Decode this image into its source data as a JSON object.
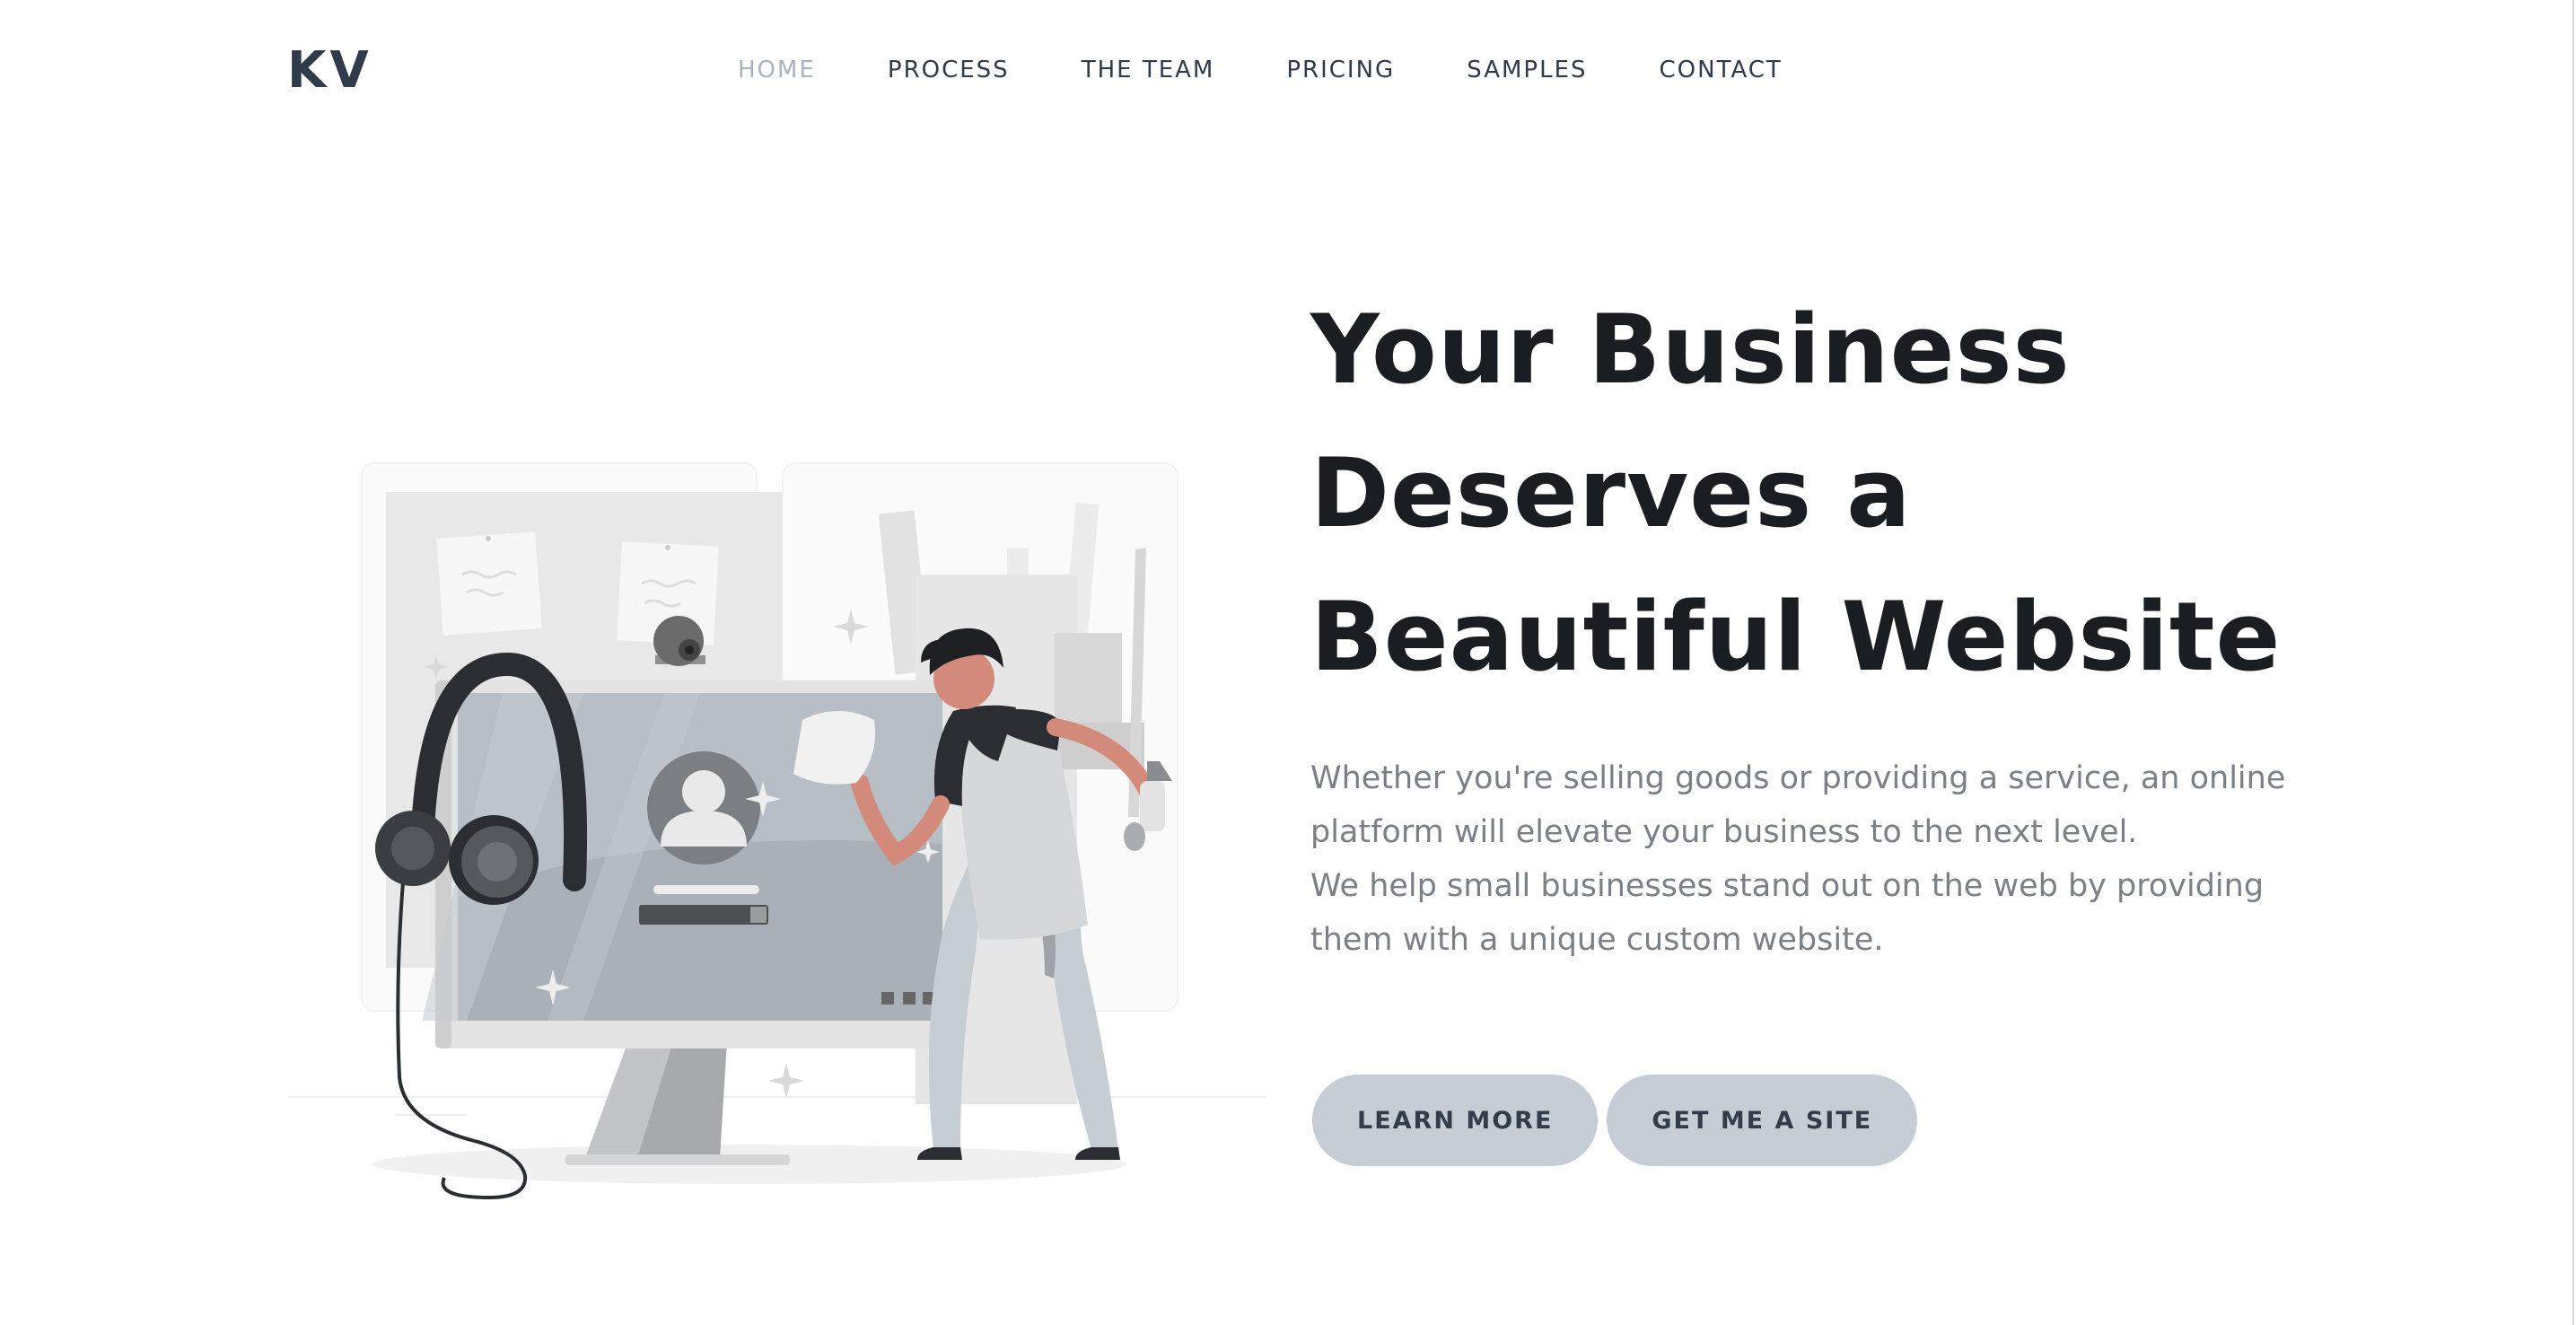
{
  "header": {
    "logo": "KV",
    "nav": [
      {
        "label": "HOME",
        "active": true
      },
      {
        "label": "PROCESS",
        "active": false
      },
      {
        "label": "THE TEAM",
        "active": false
      },
      {
        "label": "PRICING",
        "active": false
      },
      {
        "label": "SAMPLES",
        "active": false
      },
      {
        "label": "CONTACT",
        "active": false
      }
    ]
  },
  "hero": {
    "title_lines": [
      "Your Business",
      "Deserves a",
      "Beautiful Website"
    ],
    "description_lines": [
      "Whether you're selling goods or providing a service, an online",
      "platform will elevate your business to the next level.",
      "We help small businesses stand out on the web by providing",
      "them with a unique custom website."
    ],
    "buttons": {
      "learn_more": "LEARN MORE",
      "get_site": "GET ME A SITE"
    }
  },
  "illustration": {
    "subject": "person cleaning computer monitor with headphones and webcam",
    "icons": [
      "monitor-icon",
      "headphones-icon",
      "webcam-icon",
      "user-avatar-icon",
      "person-figure"
    ]
  },
  "colors": {
    "text_dark": "#1a1d21",
    "nav_text": "#2f3b4a",
    "nav_active": "#aab4c0",
    "body_text": "#7b7f86",
    "button_bg": "#c6cdd5",
    "skin": "#d48a7a"
  }
}
